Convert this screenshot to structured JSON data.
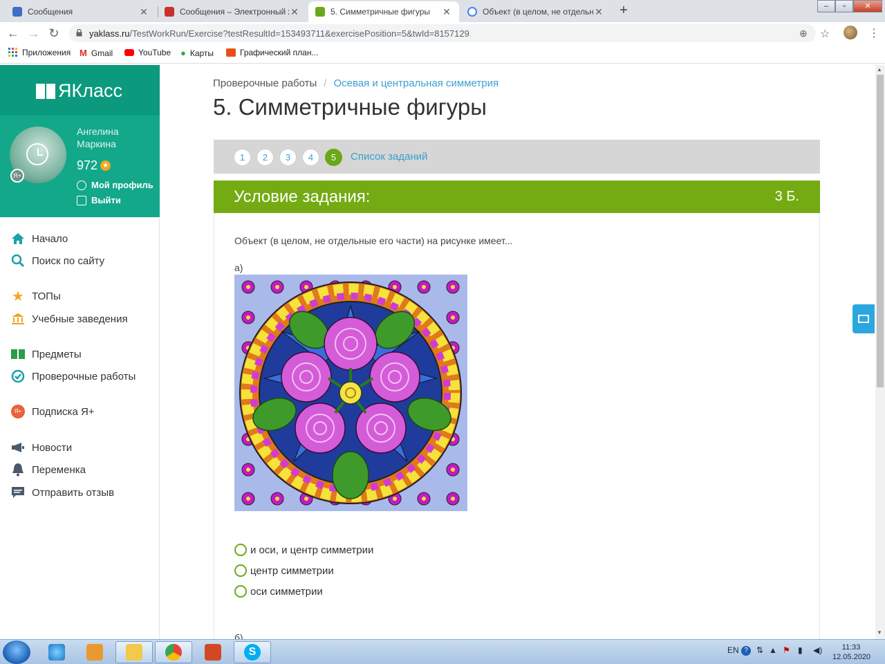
{
  "browser": {
    "tabs": [
      {
        "label": "Сообщения",
        "favicon_color": "#3f6ec4"
      },
      {
        "label": "Сообщения – Электронный журнал",
        "favicon_color": "#c8302c"
      },
      {
        "label": "5. Симметричные фигуры",
        "favicon_color": "#6aa818"
      },
      {
        "label": "Объект (в целом, не отдельные его части)",
        "favicon_color": "#4285f4"
      }
    ],
    "url_host": "yaklass.ru",
    "url_path": "/TestWorkRun/Exercise?testResultId=153493711&exercisePosition=5&twId=8157129",
    "bookmarks": [
      "Приложения",
      "Gmail",
      "YouTube",
      "Карты",
      "Графический план..."
    ]
  },
  "sidebar": {
    "brand": "ЯКласс",
    "user": {
      "name": "Ангелина Маркина",
      "points": "972",
      "badge": "Я+"
    },
    "links": {
      "profile": "Мой профиль",
      "logout": "Выйти"
    },
    "nav": [
      {
        "label": "Начало",
        "icon": "home-icon"
      },
      {
        "label": "Поиск по сайту",
        "icon": "search-icon"
      },
      {
        "label": "ТОПы",
        "icon": "star-icon"
      },
      {
        "label": "Учебные заведения",
        "icon": "institution-icon"
      },
      {
        "label": "Предметы",
        "icon": "book-icon"
      },
      {
        "label": "Проверочные работы",
        "icon": "check-circle-icon"
      },
      {
        "label": "Подписка Я+",
        "icon": "subscription-icon"
      },
      {
        "label": "Новости",
        "icon": "megaphone-icon"
      },
      {
        "label": "Переменка",
        "icon": "bell-icon"
      },
      {
        "label": "Отправить отзыв",
        "icon": "feedback-icon"
      }
    ]
  },
  "main": {
    "breadcrumb": {
      "root": "Проверочные работы",
      "current": "Осевая и центральная симметрия"
    },
    "title": "5. Симметричные фигуры",
    "pager": {
      "pages": [
        "1",
        "2",
        "3",
        "4",
        "5"
      ],
      "current": "5",
      "list_label": "Список заданий"
    },
    "condition": {
      "title": "Условие задания:",
      "points": "3 Б."
    },
    "question": "Объект (в целом, не отдельные его части) на рисунке имеет...",
    "part_a": "а)",
    "options": [
      "и оси, и центр симметрии",
      "центр симметрии",
      "оси симметрии"
    ],
    "part_b": "б)"
  },
  "taskbar": {
    "lang": "EN",
    "time": "11:33",
    "date": "12.05.2020"
  },
  "colors": {
    "brand_green": "#0b9a7e",
    "condition_green": "#74ab12",
    "link_blue": "#3aa0d0"
  }
}
